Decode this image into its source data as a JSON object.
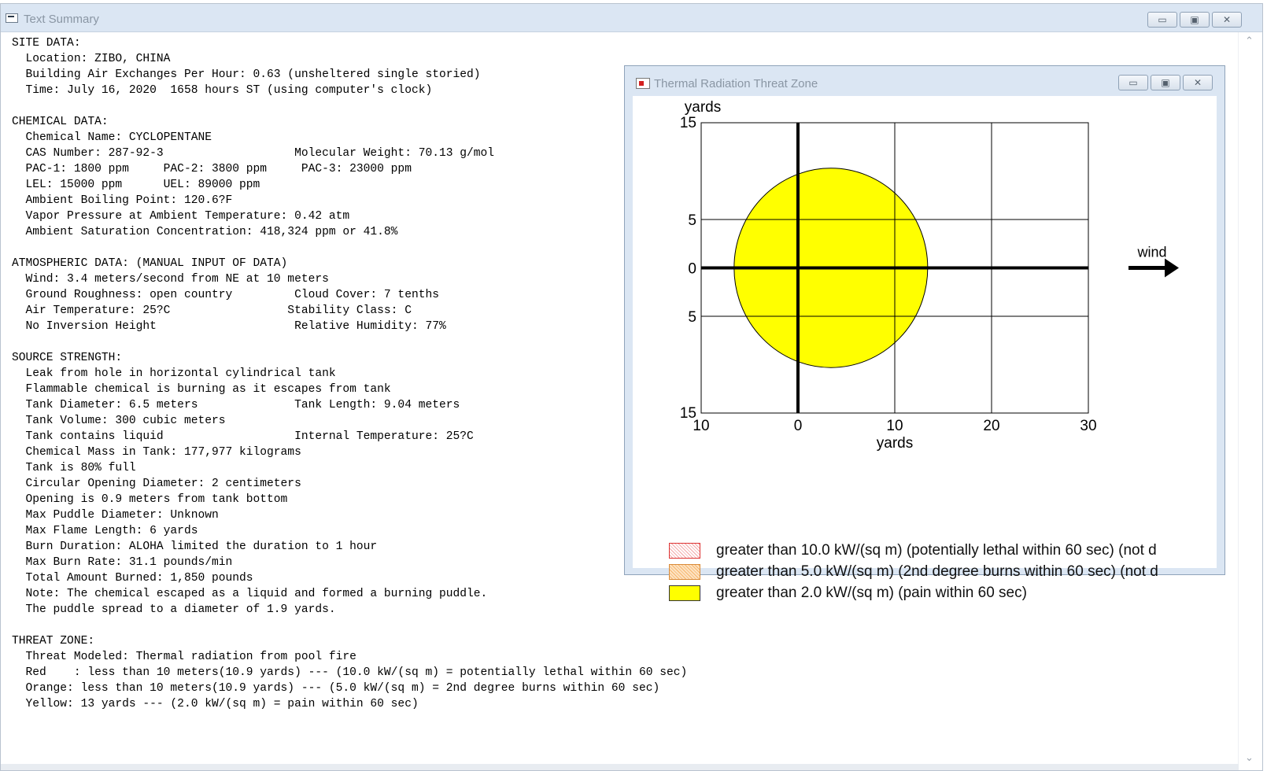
{
  "main_window": {
    "title": "Text Summary",
    "controls": {
      "minimize": "▭",
      "maximize": "▣",
      "close": "✕"
    },
    "summary_text": "SITE DATA:\n  Location: ZIBO, CHINA\n  Building Air Exchanges Per Hour: 0.63 (unsheltered single storied)\n  Time: July 16, 2020  1658 hours ST (using computer's clock)\n\nCHEMICAL DATA:\n  Chemical Name: CYCLOPENTANE\n  CAS Number: 287-92-3                   Molecular Weight: 70.13 g/mol\n  PAC-1: 1800 ppm     PAC-2: 3800 ppm     PAC-3: 23000 ppm\n  LEL: 15000 ppm      UEL: 89000 ppm\n  Ambient Boiling Point: 120.6?F\n  Vapor Pressure at Ambient Temperature: 0.42 atm\n  Ambient Saturation Concentration: 418,324 ppm or 41.8%\n\nATMOSPHERIC DATA: (MANUAL INPUT OF DATA)\n  Wind: 3.4 meters/second from NE at 10 meters\n  Ground Roughness: open country         Cloud Cover: 7 tenths\n  Air Temperature: 25?C                 Stability Class: C\n  No Inversion Height                    Relative Humidity: 77%\n\nSOURCE STRENGTH:\n  Leak from hole in horizontal cylindrical tank\n  Flammable chemical is burning as it escapes from tank\n  Tank Diameter: 6.5 meters              Tank Length: 9.04 meters\n  Tank Volume: 300 cubic meters\n  Tank contains liquid                   Internal Temperature: 25?C\n  Chemical Mass in Tank: 177,977 kilograms\n  Tank is 80% full\n  Circular Opening Diameter: 2 centimeters\n  Opening is 0.9 meters from tank bottom\n  Max Puddle Diameter: Unknown\n  Max Flame Length: 6 yards\n  Burn Duration: ALOHA limited the duration to 1 hour\n  Max Burn Rate: 31.1 pounds/min\n  Total Amount Burned: 1,850 pounds\n  Note: The chemical escaped as a liquid and formed a burning puddle.\n  The puddle spread to a diameter of 1.9 yards.\n\nTHREAT ZONE:\n  Threat Modeled: Thermal radiation from pool fire\n  Red    : less than 10 meters(10.9 yards) --- (10.0 kW/(sq m) = potentially lethal within 60 sec)\n  Orange: less than 10 meters(10.9 yards) --- (5.0 kW/(sq m) = 2nd degree burns within 60 sec)\n  Yellow: 13 yards --- (2.0 kW/(sq m) = pain within 60 sec)"
  },
  "thermal_window": {
    "title": "Thermal Radiation Threat Zone",
    "controls": {
      "minimize": "▭",
      "maximize": "▣",
      "close": "✕"
    },
    "wind_label": "wind",
    "legend": [
      {
        "swatch": "red",
        "label": "greater than 10.0 kW/(sq m) (potentially lethal within 60 sec) (not d"
      },
      {
        "swatch": "orange",
        "label": "greater than 5.0 kW/(sq m) (2nd degree burns within 60 sec) (not d"
      },
      {
        "swatch": "yellow",
        "label": "greater than 2.0 kW/(sq m) (pain within 60 sec)"
      }
    ]
  },
  "chart_data": {
    "type": "area",
    "xlabel": "yards",
    "ylabel": "yards",
    "x_ticks": [
      "10",
      "0",
      "10",
      "20",
      "30"
    ],
    "y_ticks": [
      "15",
      "5",
      "0",
      "5",
      "15"
    ],
    "xlim": [
      -10,
      30
    ],
    "ylim": [
      -15,
      15
    ],
    "grid": true,
    "threat_zones": [
      {
        "name": "yellow",
        "color": "#ffff00",
        "center_x": 3.4,
        "center_y": 0,
        "radius_x": 10,
        "radius_y": 10.3
      }
    ],
    "source_point": [
      0,
      0
    ]
  },
  "colors": {
    "titlebar": "#dbe6f3",
    "zone_yellow": "#ffff00"
  }
}
